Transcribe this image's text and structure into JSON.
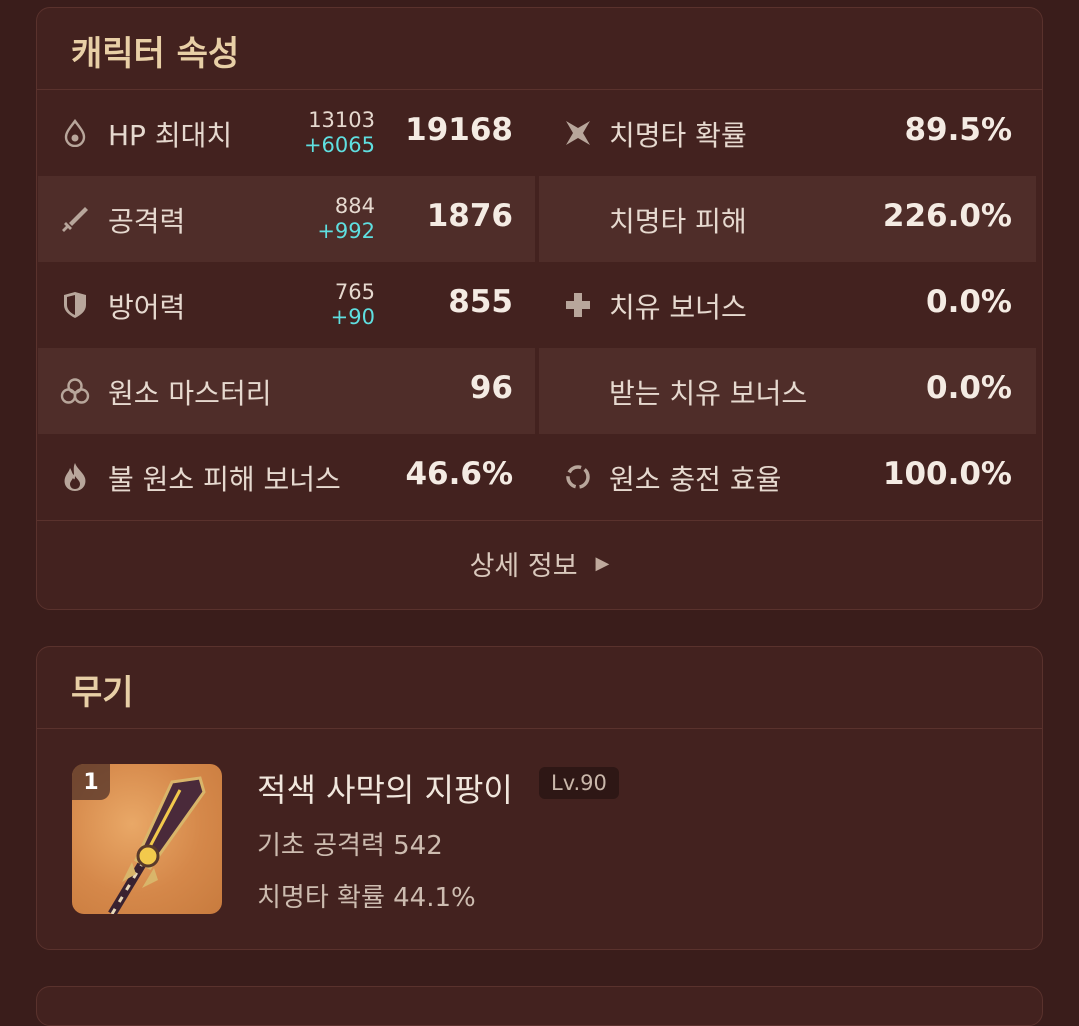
{
  "attributes": {
    "title": "캐릭터 속성",
    "rows": [
      {
        "left": {
          "icon": "hp-drop-icon",
          "label": "HP 최대치",
          "base": "13103",
          "bonus": "+6065",
          "total": "19168"
        },
        "right": {
          "icon": "crit-rate-icon",
          "label": "치명타 확률",
          "total": "89.5%"
        }
      },
      {
        "left": {
          "icon": "sword-icon",
          "label": "공격력",
          "base": "884",
          "bonus": "+992",
          "total": "1876"
        },
        "right": {
          "icon": "",
          "label": "치명타 피해",
          "total": "226.0%"
        }
      },
      {
        "left": {
          "icon": "shield-icon",
          "label": "방어력",
          "base": "765",
          "bonus": "+90",
          "total": "855"
        },
        "right": {
          "icon": "plus-heal-icon",
          "label": "치유 보너스",
          "total": "0.0%"
        }
      },
      {
        "left": {
          "icon": "elemental-mastery-icon",
          "label": "원소 마스터리",
          "total": "96"
        },
        "right": {
          "icon": "",
          "label": "받는 치유 보너스",
          "total": "0.0%"
        }
      },
      {
        "left": {
          "icon": "pyro-icon",
          "label": "불 원소 피해 보너스",
          "total": "46.6%"
        },
        "right": {
          "icon": "energy-recharge-icon",
          "label": "원소 충전 효율",
          "total": "100.0%"
        }
      }
    ],
    "detail_label": "상세 정보"
  },
  "weapon": {
    "title": "무기",
    "refinement": "1",
    "name": "적색 사막의 지팡이",
    "level": "Lv.90",
    "base_atk": "기초 공격력 542",
    "sub_stat": "치명타 확률 44.1%"
  },
  "colors": {
    "background": "#3a1d1b",
    "card": "#43221f",
    "accent_title": "#e8cfa6",
    "bonus": "#5fdfe0"
  }
}
